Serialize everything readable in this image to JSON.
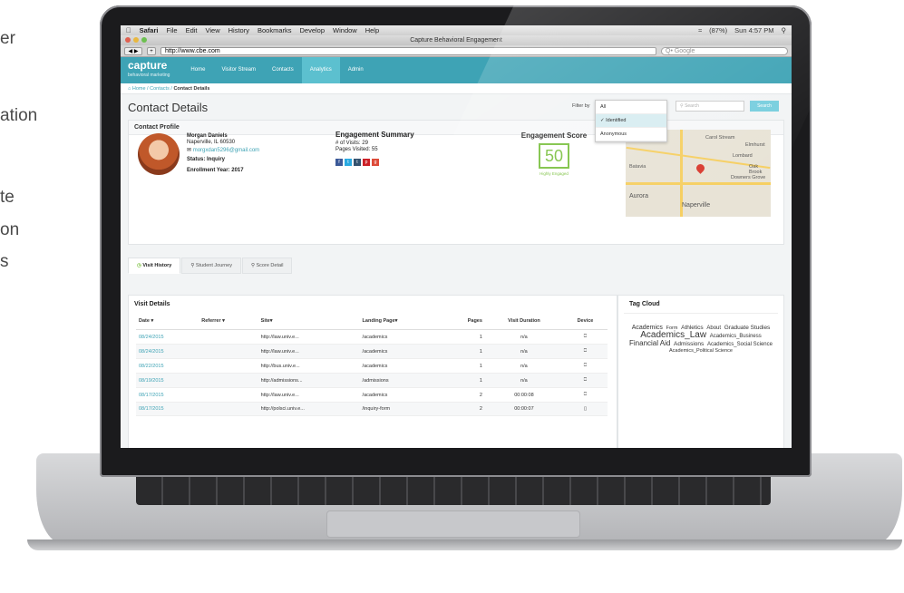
{
  "side_fragments": [
    "er",
    "ation",
    "te",
    "on",
    "s"
  ],
  "mac_menu": {
    "apple": "",
    "items": [
      "Safari",
      "File",
      "Edit",
      "View",
      "History",
      "Bookmarks",
      "Develop",
      "Window",
      "Help"
    ],
    "battery": "(87%)",
    "clock": "Sun 4:57 PM"
  },
  "browser": {
    "title": "Capture Behavioral Engagement",
    "url": "http://www.cbe.com",
    "search_placeholder": "Q• Google",
    "nav_buttons": "◀ ▶",
    "add_tab": "+"
  },
  "app": {
    "logo": "capture",
    "logo_sub": "behavioral marketing",
    "nav": [
      "Home",
      "Visitor Stream",
      "Contacts",
      "Analytics",
      "Admin"
    ],
    "active_nav": "Analytics",
    "breadcrumb": {
      "home": "Home",
      "contacts": "Contacts",
      "current": "Contact Details"
    },
    "page_title": "Contact Details",
    "filter_label": "Filter by",
    "filter_options": [
      "All",
      "Identified",
      "Anonymous"
    ],
    "filter_selected": "Identified",
    "search_placeholder": "Search",
    "search_button": "Search"
  },
  "profile": {
    "panel_title": "Contact Profile",
    "name": "Morgan Daniels",
    "location": "Naperville, IL 60530",
    "email": "morgxdan5296@gmail.com",
    "status": "Status: Inquiry",
    "enrollment": "Enrollment Year: 2017"
  },
  "engagement": {
    "title": "Engagement Summary",
    "visits": "# of Visits: 29",
    "pages": "Pages Visited: 55",
    "social": [
      "f",
      "t",
      "t",
      "p",
      "g"
    ]
  },
  "score": {
    "title": "Engagement Score",
    "value": "50",
    "label": "Highly Engaged"
  },
  "map": {
    "labels": [
      "Batavia",
      "Carol Stream",
      "Elmhurst",
      "Lombard",
      "Downers Grove",
      "Aurora",
      "Naperville",
      "Oak Brook"
    ]
  },
  "tabs": [
    "Visit History",
    "Student Journey",
    "Score Detail"
  ],
  "active_tab": "Visit History",
  "visit_details": {
    "title": "Visit Details",
    "columns": [
      "Date ▾",
      "Referrer ▾",
      "Site▾",
      "Landing Page▾",
      "Pages",
      "Visit Duration",
      "Device"
    ],
    "rows": [
      {
        "date": "08/24/2015",
        "referrer": "",
        "site": "http://law.univ.e...",
        "landing": "/academics",
        "pages": "1",
        "duration": "n/a",
        "device": "desktop"
      },
      {
        "date": "08/24/2015",
        "referrer": "",
        "site": "http://law.univ.e...",
        "landing": "/academics",
        "pages": "1",
        "duration": "n/a",
        "device": "desktop"
      },
      {
        "date": "08/22/2015",
        "referrer": "",
        "site": "http://bus.univ.e...",
        "landing": "/academics",
        "pages": "1",
        "duration": "n/a",
        "device": "desktop"
      },
      {
        "date": "08/19/2015",
        "referrer": "",
        "site": "http://admissions...",
        "landing": "/admissions",
        "pages": "1",
        "duration": "n/a",
        "device": "desktop"
      },
      {
        "date": "08/17/2015",
        "referrer": "",
        "site": "http://law.univ.e...",
        "landing": "/academics",
        "pages": "2",
        "duration": "00:00:08",
        "device": "desktop"
      },
      {
        "date": "08/17/2015",
        "referrer": "",
        "site": "http://polsci.univ.e...",
        "landing": "/inquiry-form",
        "pages": "2",
        "duration": "00:00:07",
        "device": "mobile"
      }
    ]
  },
  "tag_cloud": {
    "title": "Tag Cloud",
    "tags": [
      {
        "t": "Academics",
        "s": 7
      },
      {
        "t": "Form",
        "s": 5.5
      },
      {
        "t": "Athletics",
        "s": 6.5
      },
      {
        "t": "About",
        "s": 6
      },
      {
        "t": "Graduate Studies",
        "s": 6.5
      },
      {
        "t": "Academics_Law",
        "s": 10
      },
      {
        "t": "Academics_Business",
        "s": 6
      },
      {
        "t": "Financial Aid",
        "s": 8
      },
      {
        "t": "Admissions",
        "s": 6.5
      },
      {
        "t": "Academics_Social Science",
        "s": 6
      },
      {
        "t": "Academics_Political Science",
        "s": 5.5
      }
    ]
  }
}
